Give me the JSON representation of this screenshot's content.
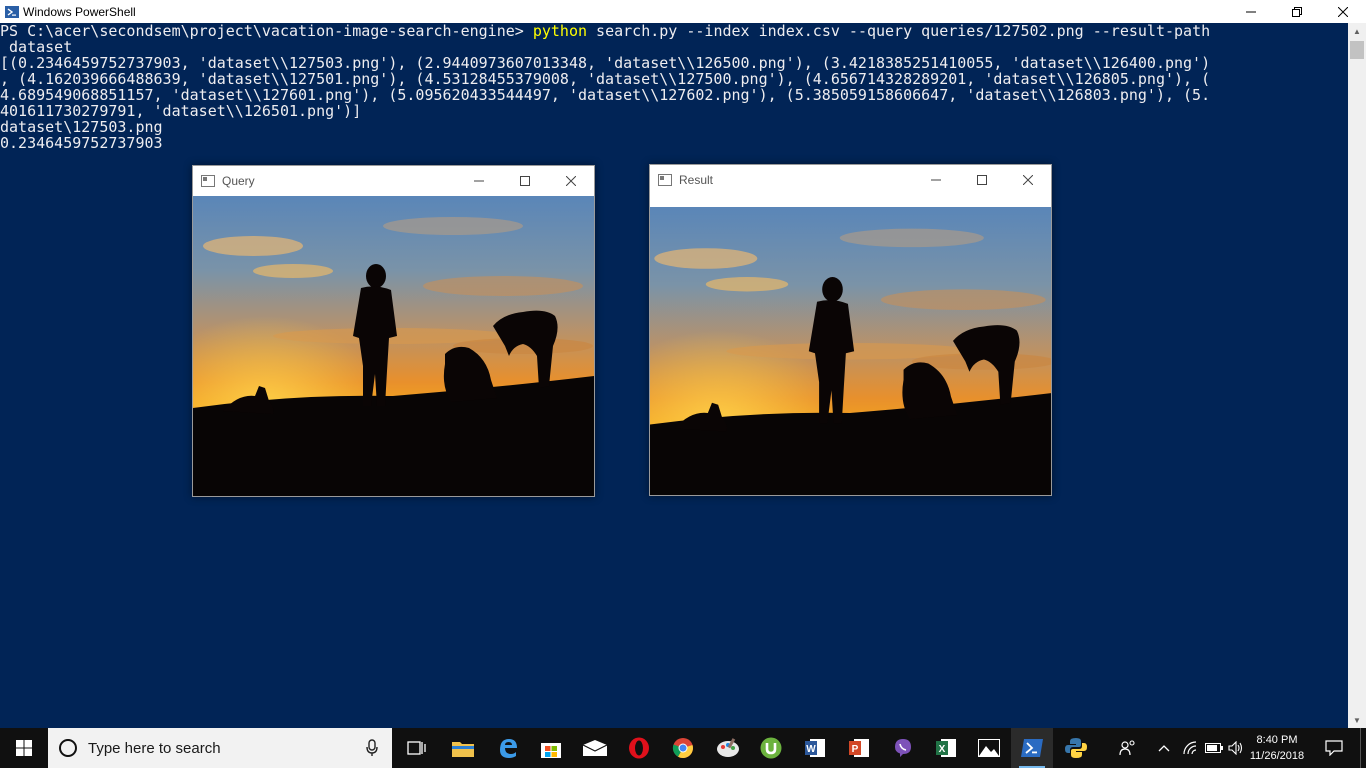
{
  "window": {
    "title": "Windows PowerShell"
  },
  "console": {
    "prompt": "PS C:\\acer\\secondsem\\project\\vacation-image-search-engine> ",
    "command_word": "python",
    "command_args": " search.py --index index.csv --query queries/127502.png --result-path",
    "lines": [
      " dataset",
      "[(0.2346459752737903, 'dataset\\\\127503.png'), (2.9440973607013348, 'dataset\\\\126500.png'), (3.4218385251410055, 'dataset\\\\126400.png')",
      ", (4.162039666488639, 'dataset\\\\127501.png'), (4.53128455379008, 'dataset\\\\127500.png'), (4.656714328289201, 'dataset\\\\126805.png'), (",
      "4.689549068851157, 'dataset\\\\127601.png'), (5.095620433544497, 'dataset\\\\127602.png'), (5.385059158606647, 'dataset\\\\126803.png'), (5.",
      "401611730279791, 'dataset\\\\126501.png')]",
      "dataset\\127503.png",
      "0.2346459752737903"
    ]
  },
  "query_window": {
    "title": "Query"
  },
  "result_window": {
    "title": "Result"
  },
  "taskbar": {
    "search_placeholder": "Type here to search",
    "time": "8:40 PM",
    "date": "11/26/2018"
  },
  "colors": {
    "console_bg": "#012456",
    "command_highlight": "#ffff00",
    "taskbar_bg": "#101010"
  }
}
